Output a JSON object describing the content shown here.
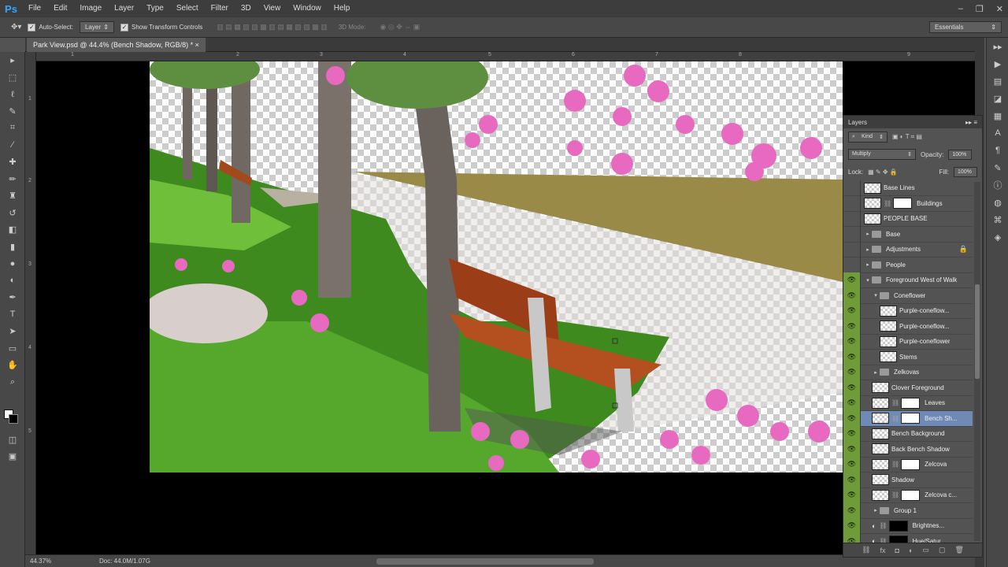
{
  "app": {
    "logo": "Ps",
    "title": "Adobe Photoshop"
  },
  "menu": [
    "File",
    "Edit",
    "Image",
    "Layer",
    "Type",
    "Select",
    "Filter",
    "3D",
    "View",
    "Window",
    "Help"
  ],
  "window_controls": {
    "minimize": "–",
    "restore": "❐",
    "close": "✕"
  },
  "options": {
    "move_icon": "move-tool-icon",
    "auto_select_label": "Auto-Select:",
    "auto_select_value": "Layer",
    "show_transform_label": "Show Transform Controls",
    "mode3d_label": "3D Mode:",
    "workspace": "Essentials"
  },
  "document": {
    "tab": "Park View.psd @ 44.4% (Bench Shadow, RGB/8) *",
    "close": "×"
  },
  "rulers": {
    "h": [
      "1",
      "2",
      "3",
      "4",
      "5",
      "6",
      "7",
      "8",
      "9"
    ],
    "v": [
      "1",
      "2",
      "3",
      "4",
      "5"
    ]
  },
  "status": {
    "zoom": "44.37%",
    "doc_info": "Doc: 44.0M/1.07G"
  },
  "layers_panel": {
    "title": "Layers",
    "filter_kind": "Kind",
    "blend_mode": "Multiply",
    "opacity_label": "Opacity:",
    "opacity_value": "100%",
    "lock_label": "Lock:",
    "fill_label": "Fill:",
    "fill_value": "100%",
    "layers": [
      {
        "name": "Base Lines",
        "type": "layer",
        "visible": false,
        "indent": 0
      },
      {
        "name": "Buildings",
        "type": "masked",
        "visible": false,
        "indent": 0
      },
      {
        "name": "PEOPLE BASE",
        "type": "layer",
        "visible": false,
        "indent": 0
      },
      {
        "name": "Base",
        "type": "group",
        "visible": false,
        "indent": 0
      },
      {
        "name": "Adjustments",
        "type": "group",
        "visible": false,
        "indent": 0,
        "locked": true
      },
      {
        "name": "People",
        "type": "group",
        "visible": false,
        "indent": 0
      },
      {
        "name": "Foreground West of Walk",
        "type": "group-open",
        "visible": true,
        "indent": 0
      },
      {
        "name": "Coneflower",
        "type": "group-open",
        "visible": true,
        "indent": 1
      },
      {
        "name": "Purple-coneflow...",
        "type": "layer",
        "visible": true,
        "indent": 2
      },
      {
        "name": "Purple-coneflow...",
        "type": "layer",
        "visible": true,
        "indent": 2
      },
      {
        "name": "Purple-coneflower",
        "type": "layer",
        "visible": true,
        "indent": 2
      },
      {
        "name": "Stems",
        "type": "layer",
        "visible": true,
        "indent": 2
      },
      {
        "name": "Zelkovas",
        "type": "group",
        "visible": true,
        "indent": 1
      },
      {
        "name": "Clover Foreground",
        "type": "layer",
        "visible": true,
        "indent": 1
      },
      {
        "name": "Leaves",
        "type": "masked",
        "visible": true,
        "indent": 1
      },
      {
        "name": "Bench Sh...",
        "type": "masked",
        "visible": true,
        "indent": 1,
        "selected": true
      },
      {
        "name": "Bench Background",
        "type": "layer",
        "visible": true,
        "indent": 1
      },
      {
        "name": "Back Bench Shadow",
        "type": "layer",
        "visible": true,
        "indent": 1
      },
      {
        "name": "Zelcova",
        "type": "masked",
        "visible": true,
        "indent": 1
      },
      {
        "name": "Shadow",
        "type": "layer",
        "visible": true,
        "indent": 1
      },
      {
        "name": "Zelcova c...",
        "type": "masked",
        "visible": true,
        "indent": 1
      },
      {
        "name": "Group 1",
        "type": "group",
        "visible": true,
        "indent": 1
      },
      {
        "name": "Brightnes...",
        "type": "adjustment",
        "visible": true,
        "indent": 1
      },
      {
        "name": "Hue/Satur...",
        "type": "adjustment",
        "visible": true,
        "indent": 1
      }
    ]
  },
  "colors": {
    "accent": "#31a8ff",
    "visible_green": "#6f9b3a",
    "selection": "#6e8ab5"
  }
}
